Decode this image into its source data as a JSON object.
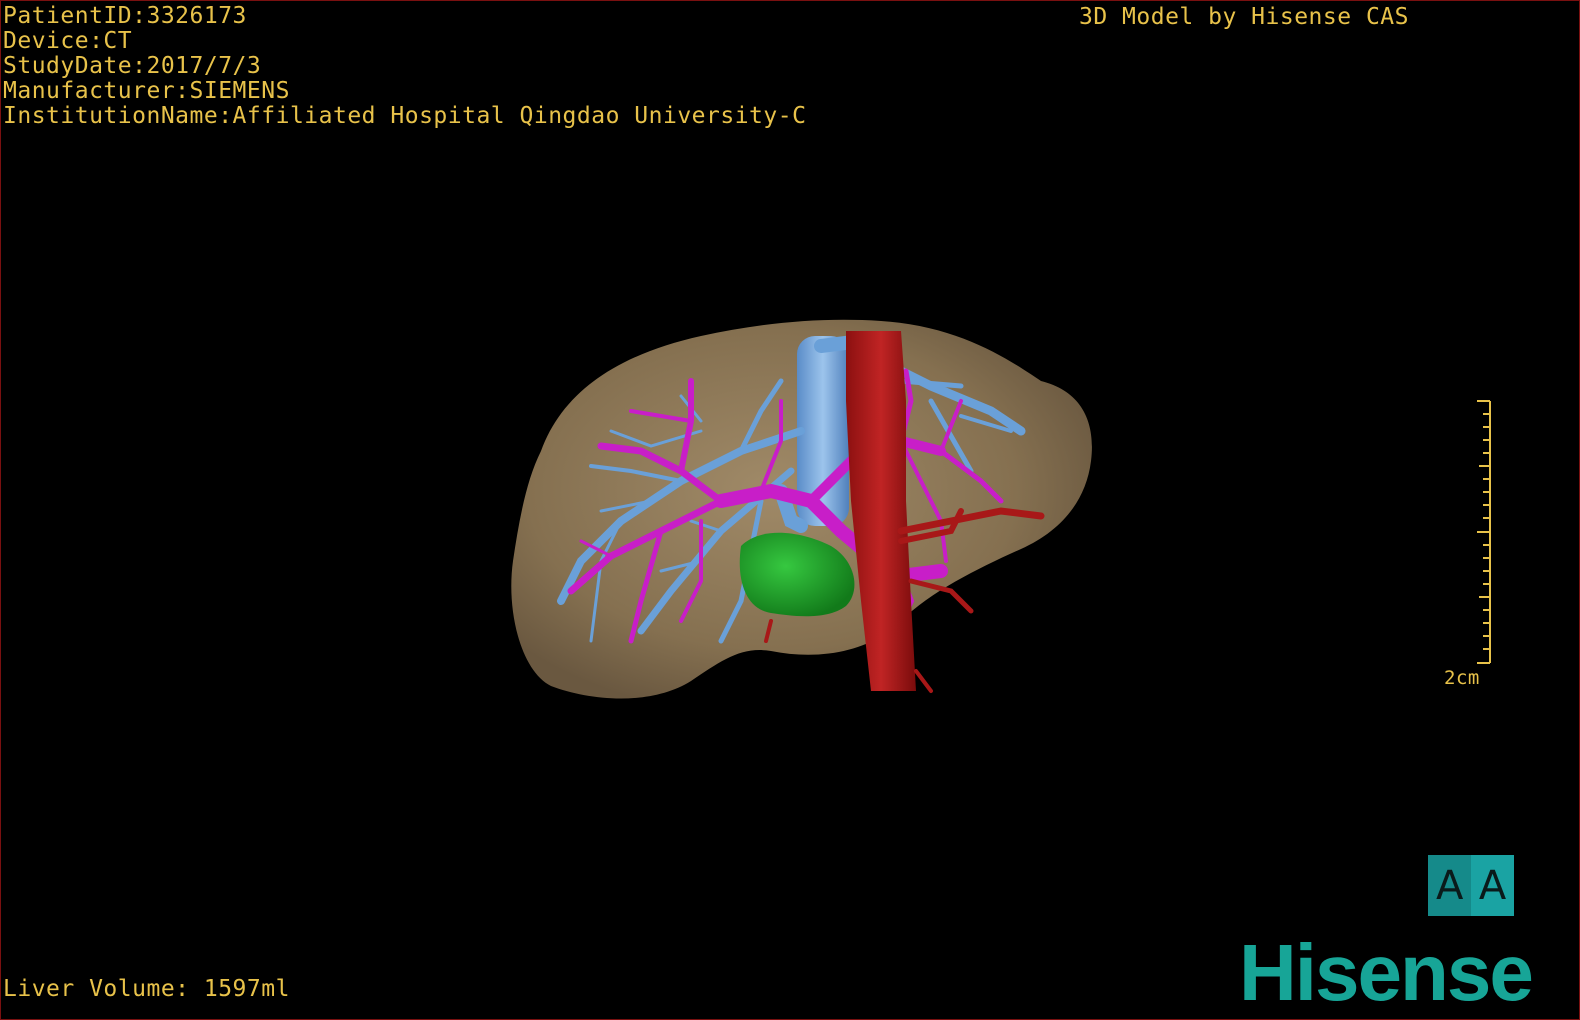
{
  "header": {
    "patient_id": "PatientID:3326173",
    "device": "Device:CT",
    "study_date": "StudyDate:2017/7/3",
    "manufacturer": "Manufacturer:SIEMENS",
    "institution": "InstitutionName:Affiliated Hospital Qingdao University-C"
  },
  "credit": "3D Model by Hisense CAS",
  "footer": {
    "liver_volume": "Liver Volume: 1597ml"
  },
  "scale_bar": {
    "label": "2cm"
  },
  "orientation": {
    "left_glyph": "A",
    "right_glyph": "A"
  },
  "brand": {
    "logo_text": "Hisense"
  },
  "colors": {
    "overlay_text": "#e8c24a",
    "liver": "#8a7456",
    "portal_vein": "#c81ec8",
    "hepatic_vein": "#6aa0d8",
    "artery_ivc": "#a81818",
    "gallbladder": "#1e9a2a",
    "brand": "#17a597",
    "border": "#7a1010"
  }
}
